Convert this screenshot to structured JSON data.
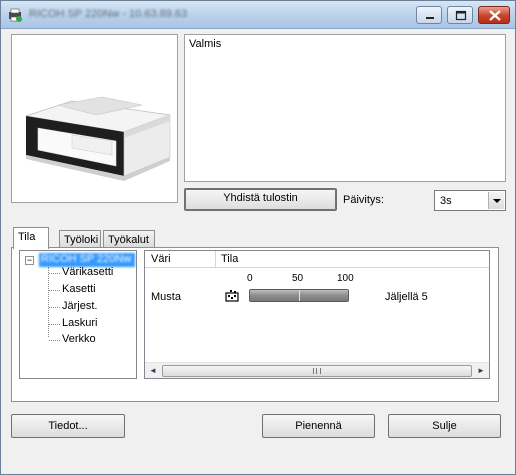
{
  "window": {
    "title": "RICOH SP 220Nw - 10.63.89.63"
  },
  "status": {
    "text": "Valmis"
  },
  "connect_button": "Yhdistä tulostin",
  "refresh": {
    "label": "Päivitys:",
    "value": "3s"
  },
  "tabs": [
    {
      "label": "Tila"
    },
    {
      "label": "Työloki"
    },
    {
      "label": "Työkalut"
    }
  ],
  "tree": {
    "root": "RICOH SP 220Nw",
    "items": [
      {
        "label": "Värikasetti"
      },
      {
        "label": "Kasetti"
      },
      {
        "label": "Järjest."
      },
      {
        "label": "Laskuri"
      },
      {
        "label": "Verkko"
      }
    ]
  },
  "list": {
    "columns": [
      "Väri",
      "Tila"
    ],
    "scale": [
      "0",
      "50",
      "100"
    ],
    "rows": [
      {
        "color": "Musta",
        "level_percent": 100,
        "remaining": "Jäljellä 5"
      }
    ]
  },
  "buttons": {
    "info": "Tiedot...",
    "minimize": "Pienennä",
    "close": "Sulje"
  }
}
